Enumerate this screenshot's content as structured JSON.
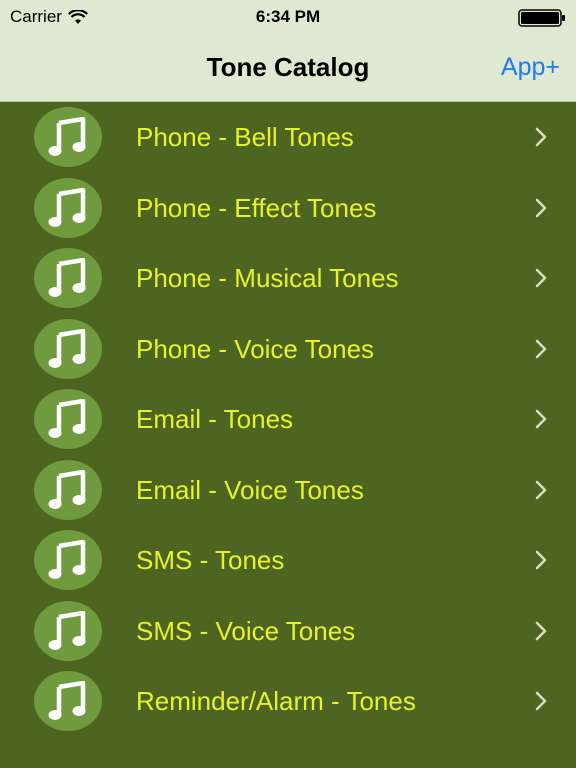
{
  "status_bar": {
    "carrier": "Carrier",
    "time": "6:34 PM"
  },
  "nav": {
    "title": "Tone Catalog",
    "right_button": "App+"
  },
  "colors": {
    "background": "#4e6421",
    "bar": "#dfe9d1",
    "label": "#e6f22a",
    "accent": "#1e7cf2",
    "icon_circle": "#6f9a3e"
  },
  "items": [
    {
      "label": "Phone - Bell Tones",
      "icon": "music-note-icon"
    },
    {
      "label": "Phone - Effect Tones",
      "icon": "music-note-icon"
    },
    {
      "label": "Phone - Musical Tones",
      "icon": "music-note-icon"
    },
    {
      "label": "Phone - Voice Tones",
      "icon": "music-note-icon"
    },
    {
      "label": "Email - Tones",
      "icon": "music-note-icon"
    },
    {
      "label": "Email - Voice Tones",
      "icon": "music-note-icon"
    },
    {
      "label": "SMS - Tones",
      "icon": "music-note-icon"
    },
    {
      "label": "SMS - Voice Tones",
      "icon": "music-note-icon"
    },
    {
      "label": "Reminder/Alarm - Tones",
      "icon": "music-note-icon"
    }
  ]
}
